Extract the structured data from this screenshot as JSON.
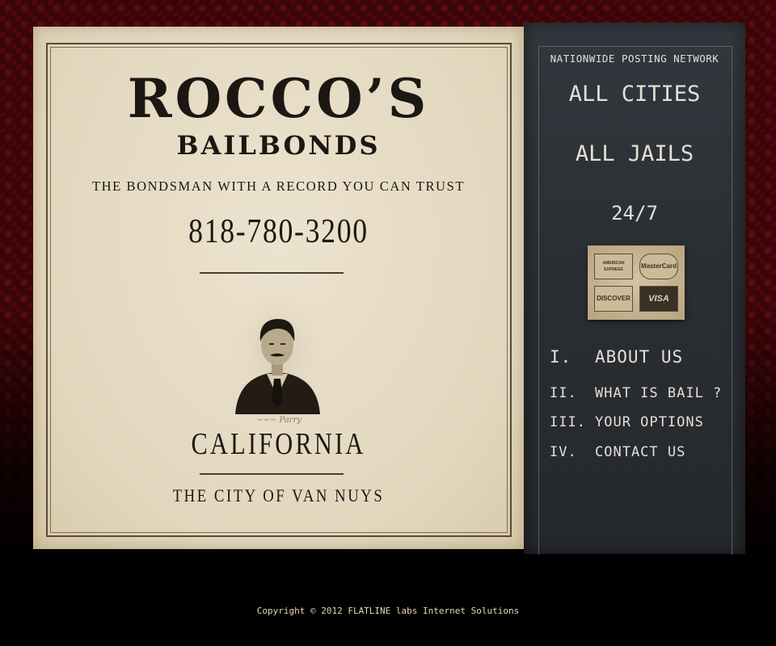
{
  "header": {
    "name": "ROCCO’S",
    "business": "BAILBONDS",
    "tagline": "THE BONDSMAN WITH A RECORD YOU CAN TRUST",
    "phone": "818-780-3200"
  },
  "location": {
    "signature": "~~~ Parry",
    "state": "CALIFORNIA",
    "city": "THE CITY OF VAN NUYS"
  },
  "sidebar": {
    "network": "NATIONWIDE POSTING NETWORK",
    "cities": "ALL CITIES",
    "jails": "ALL JAILS",
    "hours": "24/7",
    "cards": {
      "amex": "AMERICAN EXPRESS",
      "mastercard": "MasterCard",
      "discover": "DISCOVER",
      "visa": "VISA"
    }
  },
  "menu": [
    {
      "num": "I.",
      "label": "ABOUT US"
    },
    {
      "num": "II.",
      "label": "WHAT IS BAIL ?"
    },
    {
      "num": "III.",
      "label": "YOUR OPTIONS"
    },
    {
      "num": "IV.",
      "label": "CONTACT US"
    }
  ],
  "footer": {
    "copyright": "Copyright © 2012  FLATLINE labs Internet Solutions"
  },
  "colors": {
    "background": "#3a0508",
    "paper": "#e6dcc6",
    "ink": "#1c1712",
    "sidebar": "#2b2f34",
    "sidebar_text": "#e4e0d6",
    "footer_text": "#e8d9b0"
  }
}
